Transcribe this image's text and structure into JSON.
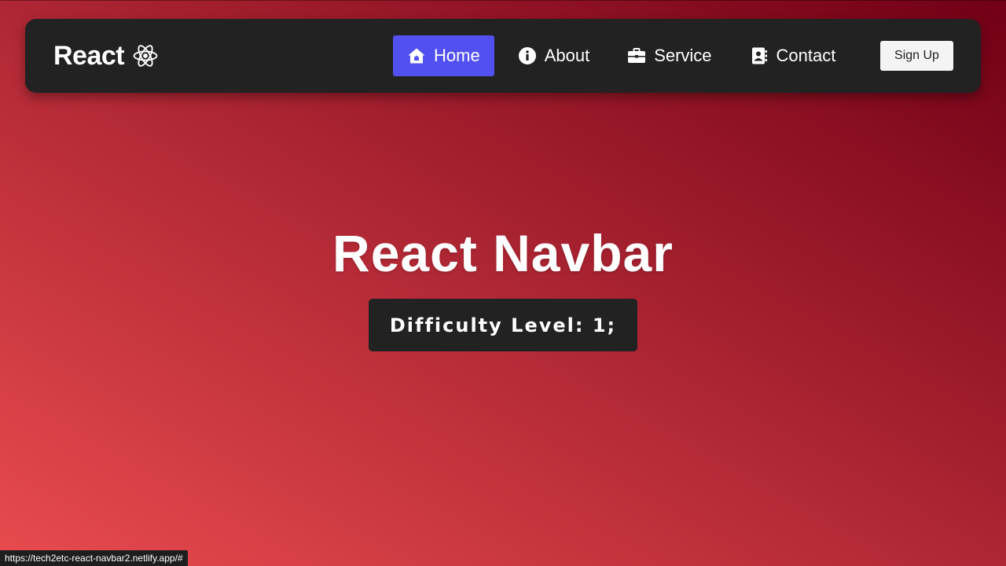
{
  "navbar": {
    "brand": {
      "text": "React",
      "icon": "react-atom-icon"
    },
    "items": [
      {
        "label": "Home",
        "icon": "home-icon",
        "active": true
      },
      {
        "label": "About",
        "icon": "info-circle-icon",
        "active": false
      },
      {
        "label": "Service",
        "icon": "briefcase-icon",
        "active": false
      },
      {
        "label": "Contact",
        "icon": "address-book-icon",
        "active": false
      }
    ],
    "signup_label": "Sign Up"
  },
  "hero": {
    "title": "React Navbar",
    "badge": "Difficulty Level: 1;"
  },
  "status_url": "https://tech2etc-react-navbar2.netlify.app/#",
  "colors": {
    "navbar_bg": "#222222",
    "active_item": "#5250f0",
    "gradient_start": "#e84b4e",
    "gradient_end": "#720016"
  }
}
